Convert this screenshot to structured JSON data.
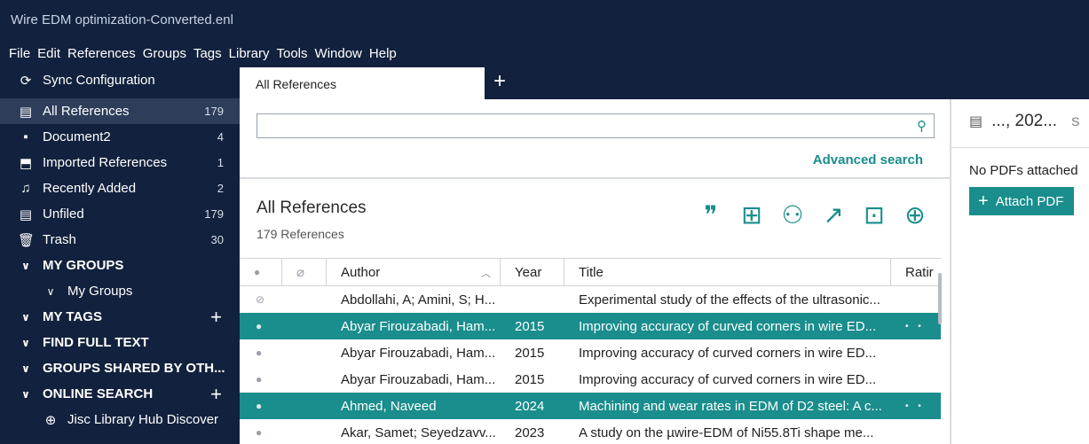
{
  "window": {
    "title": "Wire EDM optimization-Converted.enl"
  },
  "menu": [
    "File",
    "Edit",
    "References",
    "Groups",
    "Tags",
    "Library",
    "Tools",
    "Window",
    "Help"
  ],
  "sidebar": {
    "sync_label": "Sync Configuration",
    "items": [
      {
        "label": "All References",
        "count": "179"
      },
      {
        "label": "Document2",
        "count": "4"
      },
      {
        "label": "Imported References",
        "count": "1"
      },
      {
        "label": "Recently Added",
        "count": "2"
      },
      {
        "label": "Unfiled",
        "count": "179"
      },
      {
        "label": "Trash",
        "count": "30"
      }
    ],
    "sections": [
      {
        "label": "MY GROUPS"
      },
      {
        "label": "My Groups"
      },
      {
        "label": "MY TAGS"
      },
      {
        "label": "FIND FULL TEXT"
      },
      {
        "label": "GROUPS SHARED BY OTH..."
      },
      {
        "label": "ONLINE SEARCH"
      },
      {
        "label": "Jisc Library Hub Discover"
      }
    ]
  },
  "tabs": {
    "active": "All References",
    "add": "+"
  },
  "search": {
    "value": "",
    "advanced_label": "Advanced search"
  },
  "list": {
    "title": "All References",
    "count_label": "179 References"
  },
  "table": {
    "headers": {
      "author": "Author",
      "year": "Year",
      "title": "Title",
      "rating": "Ratir"
    },
    "rows": [
      {
        "author": "Abdollahi, A; Amini, S; H...",
        "year": "",
        "title": "Experimental study of the effects of the ultrasonic...",
        "selected": false,
        "read": true
      },
      {
        "author": "Abyar Firouzabadi, Ham...",
        "year": "2015",
        "title": "Improving accuracy of curved corners in wire ED...",
        "selected": true,
        "read": false
      },
      {
        "author": "Abyar Firouzabadi, Ham...",
        "year": "2015",
        "title": "Improving accuracy of curved corners in wire ED...",
        "selected": false,
        "read": false
      },
      {
        "author": "Abyar Firouzabadi, Ham...",
        "year": "2015",
        "title": "Improving accuracy of curved corners in wire ED...",
        "selected": false,
        "read": false
      },
      {
        "author": "Ahmed, Naveed",
        "year": "2024",
        "title": "Machining and wear rates in EDM of D2 steel: A c...",
        "selected": true,
        "read": false
      },
      {
        "author": "Akar, Samet; Seyedzavv...",
        "year": "2023",
        "title": "A study on the µwire-EDM of Ni55.8Ti shape me...",
        "selected": false,
        "read": false
      }
    ]
  },
  "right_pane": {
    "header": "..., 202...",
    "header_extra": "S",
    "no_pdf": "No PDFs attached",
    "attach_label": "Attach PDF"
  },
  "colors": {
    "sidebar_bg": "#12213d",
    "accent": "#1a8d8d",
    "selected_row": "#1a8d8d"
  }
}
